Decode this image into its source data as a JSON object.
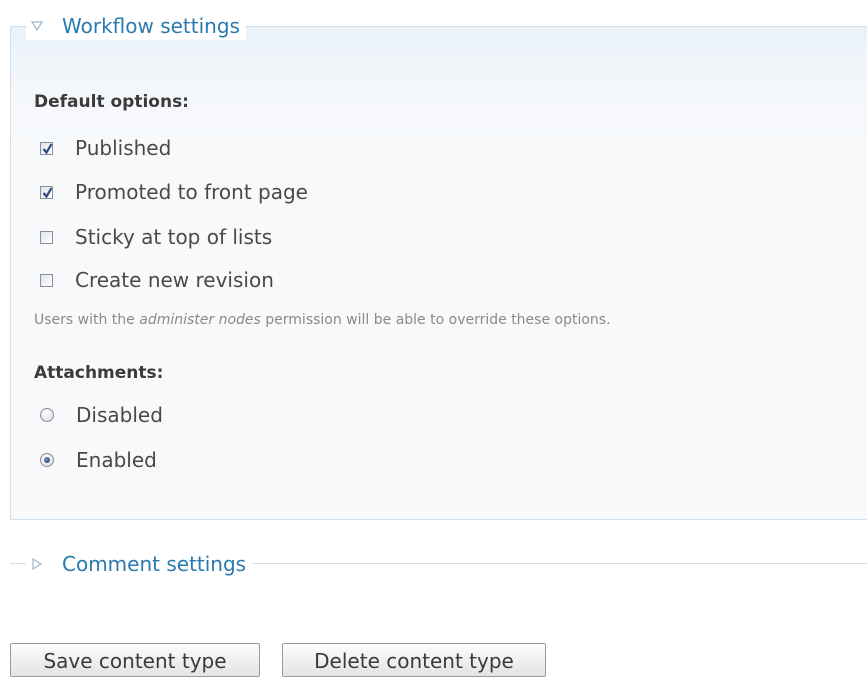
{
  "workflow_fieldset": {
    "legend": "Workflow settings",
    "default_options": {
      "heading": "Default options:",
      "options": [
        {
          "label": "Published",
          "checked": true
        },
        {
          "label": "Promoted to front page",
          "checked": true
        },
        {
          "label": "Sticky at top of lists",
          "checked": false
        },
        {
          "label": "Create new revision",
          "checked": false
        }
      ],
      "description_prefix": "Users with the ",
      "description_em": "administer nodes",
      "description_suffix": " permission will be able to override these options."
    },
    "attachments": {
      "heading": "Attachments:",
      "options": [
        {
          "label": "Disabled",
          "selected": false
        },
        {
          "label": "Enabled",
          "selected": true
        }
      ]
    }
  },
  "comment_fieldset": {
    "legend": "Comment settings"
  },
  "buttons": {
    "save": "Save content type",
    "delete": "Delete content type"
  },
  "colors": {
    "legend_text": "#2a7ab0",
    "fieldset_border": "#cfe0ec",
    "fieldset_bg": "#f7f9fb"
  }
}
